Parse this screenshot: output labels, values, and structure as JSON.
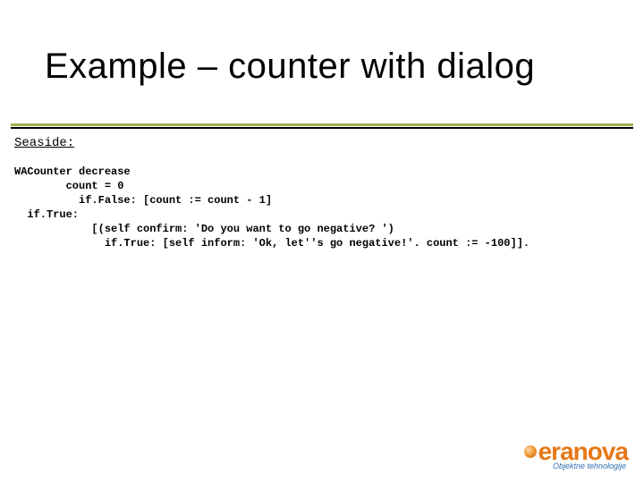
{
  "title": "Example – counter with dialog",
  "section_label": "Seaside:",
  "code": {
    "l1": "WACounter decrease",
    "l2": "        count = 0",
    "l3": "          if.False: [count := count - 1]",
    "l4": "  if.True:",
    "l5": "            [(self confirm: 'Do you want to go negative? ')",
    "l6": "              if.True: [self inform: 'Ok, let''s go negative!'. count := -100]]."
  },
  "logo": {
    "word": "eranova",
    "tagline": "Objektne tehnologije"
  }
}
